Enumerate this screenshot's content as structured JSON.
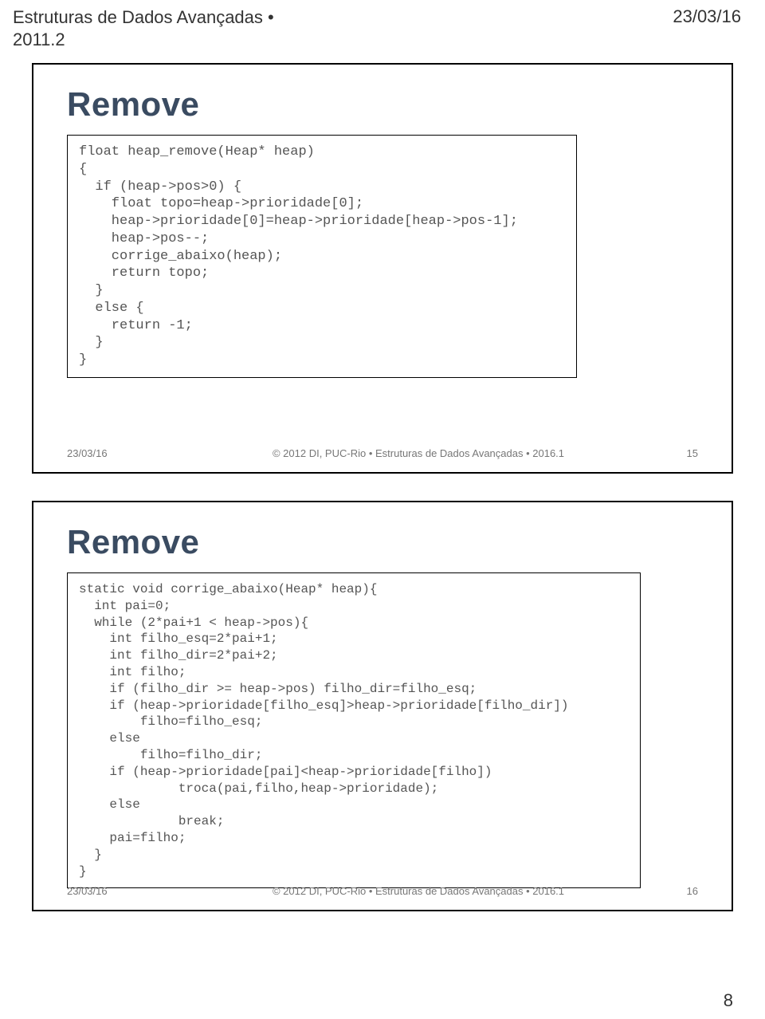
{
  "header": {
    "left_line1": "Estruturas de Dados Avançadas •",
    "left_line2": "2011.2",
    "right": "23/03/16"
  },
  "slide1": {
    "title": "Remove",
    "code": "float heap_remove(Heap* heap)\n{\n  if (heap->pos>0) {\n    float topo=heap->prioridade[0];\n    heap->prioridade[0]=heap->prioridade[heap->pos-1];\n    heap->pos--;\n    corrige_abaixo(heap);\n    return topo;\n  }\n  else {\n    return -1;\n  }\n}",
    "footer_left": "23/03/16",
    "footer_mid": "© 2012 DI, PUC-Rio • Estruturas de Dados Avançadas • 2016.1",
    "footer_right": "15"
  },
  "slide2": {
    "title": "Remove",
    "code": "static void corrige_abaixo(Heap* heap){\n  int pai=0;\n  while (2*pai+1 < heap->pos){\n    int filho_esq=2*pai+1;\n    int filho_dir=2*pai+2;\n    int filho;\n    if (filho_dir >= heap->pos) filho_dir=filho_esq;\n    if (heap->prioridade[filho_esq]>heap->prioridade[filho_dir])\n        filho=filho_esq;\n    else\n        filho=filho_dir;\n    if (heap->prioridade[pai]<heap->prioridade[filho])\n             troca(pai,filho,heap->prioridade);\n    else\n             break;\n    pai=filho;\n  }\n}",
    "footer_left": "23/03/16",
    "footer_mid": "© 2012 DI, PUC-Rio • Estruturas de Dados Avançadas • 2016.1",
    "footer_right": "16"
  },
  "page_number": "8"
}
